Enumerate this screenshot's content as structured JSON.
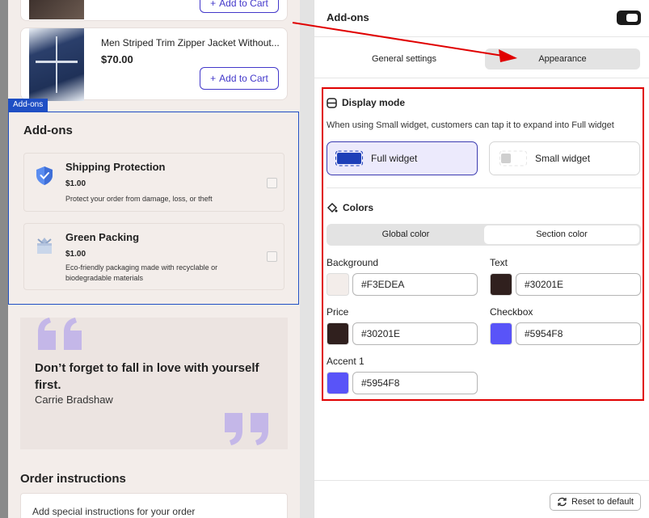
{
  "preview": {
    "products": [
      {
        "title": "",
        "price": "",
        "button": "Add to Cart"
      },
      {
        "title": "Men Striped Trim Zipper Jacket Without...",
        "price": "$70.00",
        "button": "Add to Cart"
      }
    ],
    "addons_tag": "Add-ons",
    "addons_heading": "Add-ons",
    "addons": [
      {
        "title": "Shipping Protection",
        "price": "$1.00",
        "description": "Protect your order from damage, loss, or theft",
        "icon": "shield-icon"
      },
      {
        "title": "Green Packing",
        "price": "$1.00",
        "description": "Eco-friendly packaging made with recyclable or biodegradable materials",
        "icon": "package-icon"
      }
    ],
    "quote": {
      "text": "Don’t forget to fall in love with yourself first.",
      "author": "Carrie Bradshaw"
    },
    "order_instructions": {
      "title": "Order instructions",
      "placeholder": "Add special instructions for your order"
    }
  },
  "panel": {
    "title": "Add-ons",
    "tabs": {
      "general": "General settings",
      "appearance": "Appearance"
    },
    "display_mode": {
      "title": "Display mode",
      "hint": "When using Small widget, customers can tap it to expand into Full widget",
      "full_widget": "Full widget",
      "small_widget": "Small widget",
      "selected": "Full widget"
    },
    "colors": {
      "title": "Colors",
      "tabs": {
        "global": "Global color",
        "section": "Section color"
      },
      "active_tab": "Section color",
      "fields": {
        "background": {
          "label": "Background",
          "value": "#F3EDEA"
        },
        "text": {
          "label": "Text",
          "value": "#30201E"
        },
        "price": {
          "label": "Price",
          "value": "#30201E"
        },
        "checkbox": {
          "label": "Checkbox",
          "value": "#5954F8"
        },
        "accent1": {
          "label": "Accent 1",
          "value": "#5954F8"
        }
      }
    },
    "reset_label": "Reset to default"
  },
  "colors": {
    "annotation_red": "#e00000",
    "brand_accent": "#4338ca",
    "selection_blue": "#1f4fc4"
  }
}
